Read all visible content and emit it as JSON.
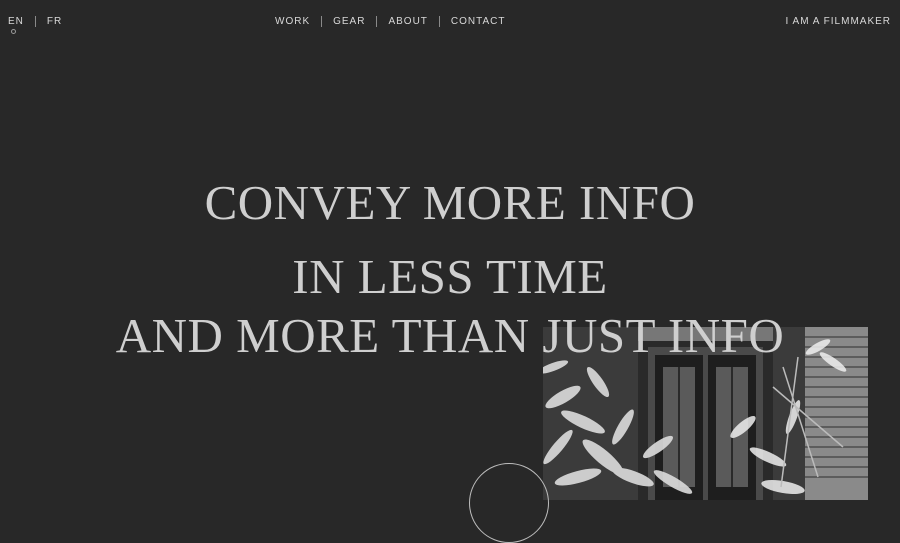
{
  "lang_switch": {
    "items": [
      {
        "label": "EN",
        "active": true
      },
      {
        "label": "FR",
        "active": false
      }
    ]
  },
  "nav": {
    "items": [
      {
        "label": "WORK"
      },
      {
        "label": "GEAR"
      },
      {
        "label": "ABOUT"
      },
      {
        "label": "CONTACT"
      }
    ]
  },
  "header": {
    "role_link": "I AM A FILMMAKER"
  },
  "hero": {
    "lines": [
      "CONVEY MORE INFO",
      "IN LESS TIME",
      "AND MORE THAN JUST INFO"
    ]
  },
  "colors": {
    "background": "#282828",
    "text": "#cfcfcf"
  }
}
